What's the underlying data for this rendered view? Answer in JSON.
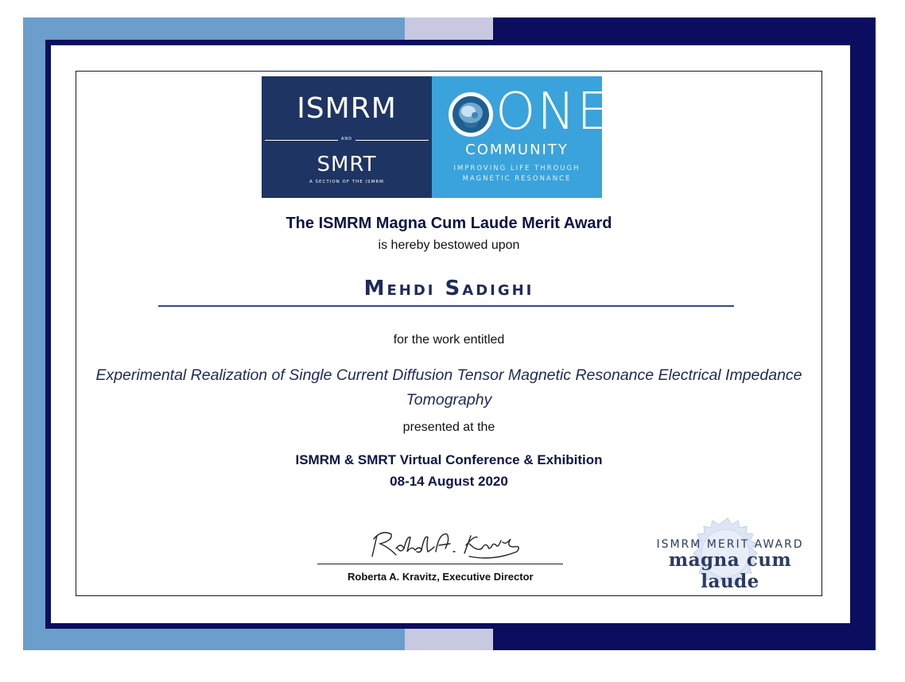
{
  "colors": {
    "light_blue": "#6b9ecb",
    "lavender": "#c8c9e0",
    "navy": "#0b0d5e",
    "logo_navy": "#1e3462",
    "logo_cyan": "#3aa3dc",
    "text_navy": "#0e1546"
  },
  "logo": {
    "left_main": "ISMRM",
    "left_and": "AND",
    "left_sub": "SMRT",
    "left_caption": "A SECTION OF THE ISMRM",
    "right_main": "ONE",
    "right_sub": "COMMUNITY",
    "right_tag_1": "IMPROVING LIFE THROUGH",
    "right_tag_2": "MAGNETIC RESONANCE",
    "right_icon": "brain-mri-icon"
  },
  "certificate": {
    "award_title": "The ISMRM Magna Cum Laude Merit Award",
    "bestowed_line": "is hereby bestowed upon",
    "recipient": "Mehdi Sadighi",
    "work_intro": "for the work entitled",
    "work_title": "Experimental Realization of Single Current Diffusion Tensor Magnetic Resonance Electrical Impedance Tomography",
    "presented_line": "presented at the",
    "conference": "ISMRM & SMRT Virtual Conference & Exhibition",
    "dates": "08-14 August 2020"
  },
  "signature": {
    "signed_text": "Roberta A. Kravitz",
    "signer_line": "Roberta A. Kravitz, Executive Director"
  },
  "seal": {
    "top_line": "ISMRM MERIT AWARD",
    "bottom_line": "magna cum laude"
  }
}
